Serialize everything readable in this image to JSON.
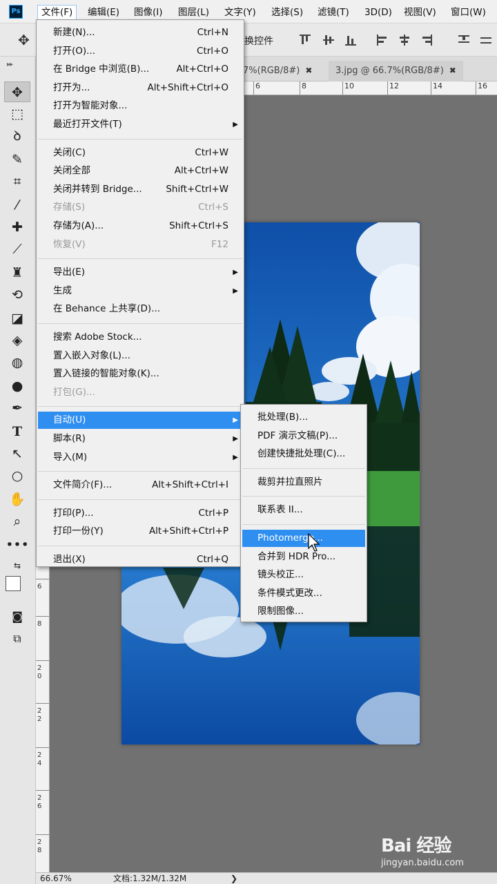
{
  "app": {
    "logo": "Ps"
  },
  "menubar": {
    "items": [
      "文件(F)",
      "编辑(E)",
      "图像(I)",
      "图层(L)",
      "文字(Y)",
      "选择(S)",
      "滤镜(T)",
      "3D(D)",
      "视图(V)",
      "窗口(W)"
    ]
  },
  "options": {
    "label": "换控件"
  },
  "tabs": [
    {
      "label": "7%(RGB/8#)",
      "close": "✖"
    },
    {
      "label": "3.jpg @ 66.7%(RGB/8#)",
      "close": "✖"
    }
  ],
  "ruler_h": [
    "6",
    "8",
    "10",
    "12",
    "14",
    "16"
  ],
  "ruler_v": [
    "6",
    "8",
    "20",
    "22",
    "24",
    "26",
    "28"
  ],
  "file_menu": {
    "groups": [
      [
        {
          "label": "新建(N)...",
          "shortcut": "Ctrl+N"
        },
        {
          "label": "打开(O)...",
          "shortcut": "Ctrl+O"
        },
        {
          "label": "在 Bridge 中浏览(B)...",
          "shortcut": "Alt+Ctrl+O"
        },
        {
          "label": "打开为...",
          "shortcut": "Alt+Shift+Ctrl+O"
        },
        {
          "label": "打开为智能对象...",
          "shortcut": ""
        },
        {
          "label": "最近打开文件(T)",
          "shortcut": "",
          "submenu": true
        }
      ],
      [
        {
          "label": "关闭(C)",
          "shortcut": "Ctrl+W"
        },
        {
          "label": "关闭全部",
          "shortcut": "Alt+Ctrl+W"
        },
        {
          "label": "关闭并转到 Bridge...",
          "shortcut": "Shift+Ctrl+W"
        },
        {
          "label": "存储(S)",
          "shortcut": "Ctrl+S",
          "disabled": true
        },
        {
          "label": "存储为(A)...",
          "shortcut": "Shift+Ctrl+S"
        },
        {
          "label": "恢复(V)",
          "shortcut": "F12",
          "disabled": true
        }
      ],
      [
        {
          "label": "导出(E)",
          "shortcut": "",
          "submenu": true
        },
        {
          "label": "生成",
          "shortcut": "",
          "submenu": true
        },
        {
          "label": "在 Behance 上共享(D)...",
          "shortcut": ""
        }
      ],
      [
        {
          "label": "搜索 Adobe Stock...",
          "shortcut": ""
        },
        {
          "label": "置入嵌入对象(L)...",
          "shortcut": ""
        },
        {
          "label": "置入链接的智能对象(K)...",
          "shortcut": ""
        },
        {
          "label": "打包(G)...",
          "shortcut": "",
          "disabled": true
        }
      ],
      [
        {
          "label": "自动(U)",
          "shortcut": "",
          "submenu": true,
          "highlighted": true
        },
        {
          "label": "脚本(R)",
          "shortcut": "",
          "submenu": true
        },
        {
          "label": "导入(M)",
          "shortcut": "",
          "submenu": true
        }
      ],
      [
        {
          "label": "文件简介(F)...",
          "shortcut": "Alt+Shift+Ctrl+I"
        }
      ],
      [
        {
          "label": "打印(P)...",
          "shortcut": "Ctrl+P"
        },
        {
          "label": "打印一份(Y)",
          "shortcut": "Alt+Shift+Ctrl+P"
        }
      ],
      [
        {
          "label": "退出(X)",
          "shortcut": "Ctrl+Q"
        }
      ]
    ]
  },
  "auto_submenu": {
    "groups": [
      [
        {
          "label": "批处理(B)..."
        },
        {
          "label": "PDF 演示文稿(P)..."
        },
        {
          "label": "创建快捷批处理(C)..."
        }
      ],
      [
        {
          "label": "裁剪并拉直照片"
        }
      ],
      [
        {
          "label": "联系表 II..."
        }
      ],
      [
        {
          "label": "Photomerge...",
          "highlighted": true
        },
        {
          "label": "合并到 HDR Pro..."
        },
        {
          "label": "镜头校正..."
        },
        {
          "label": "条件模式更改..."
        },
        {
          "label": "限制图像..."
        }
      ]
    ]
  },
  "status": {
    "zoom": "66.67%",
    "doc": "文档:1.32M/1.32M",
    "arrow": "❯"
  },
  "watermark": {
    "logo": "Bai 经验",
    "sub": "jingyan.baidu.com"
  },
  "colors": {
    "highlight": "#2f8ff1",
    "menu_bg": "#f0f0f0",
    "sky": "#1e66b8"
  }
}
